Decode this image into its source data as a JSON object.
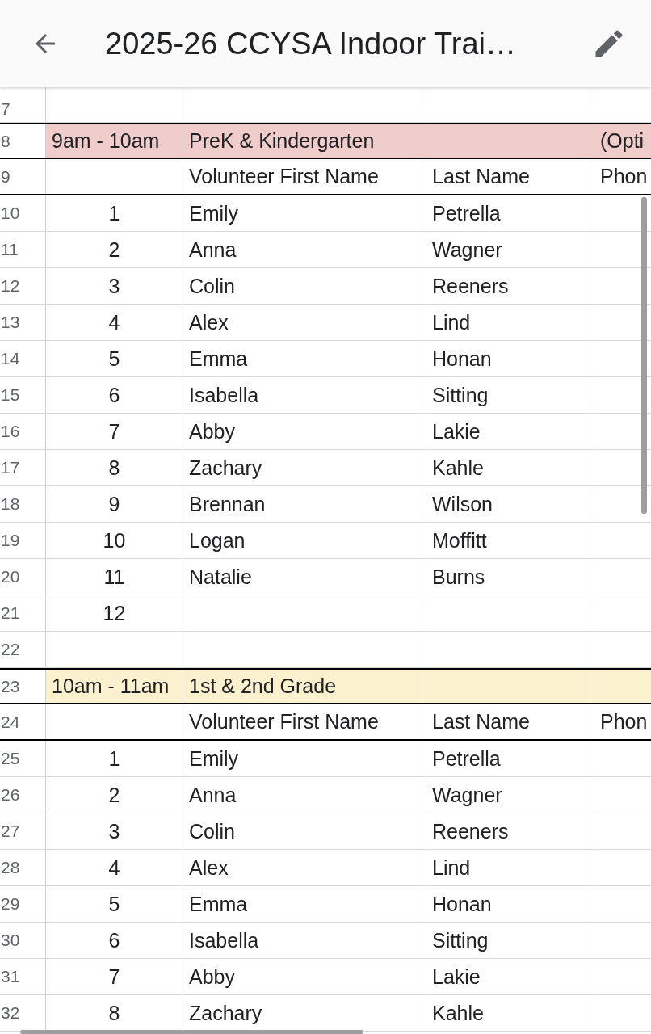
{
  "app_bar": {
    "title": "2025-26 CCYSA Indoor Trai…"
  },
  "rows": [
    {
      "kind": "blank",
      "number": "7"
    },
    {
      "kind": "section",
      "number": "8",
      "time": "9am - 10am",
      "title": "PreK & Kindergarten",
      "note": "(Opti",
      "color": "#f0cccb"
    },
    {
      "kind": "header",
      "number": "9",
      "first": "Volunteer First Name",
      "last": "Last Name",
      "phone": "Phon"
    },
    {
      "kind": "entry",
      "number": "10",
      "index": "1",
      "first": "Emily",
      "last": "Petrella"
    },
    {
      "kind": "entry",
      "number": "11",
      "index": "2",
      "first": "Anna",
      "last": "Wagner"
    },
    {
      "kind": "entry",
      "number": "12",
      "index": "3",
      "first": "Colin",
      "last": "Reeners"
    },
    {
      "kind": "entry",
      "number": "13",
      "index": "4",
      "first": "Alex",
      "last": "Lind"
    },
    {
      "kind": "entry",
      "number": "14",
      "index": "5",
      "first": "Emma",
      "last": "Honan"
    },
    {
      "kind": "entry",
      "number": "15",
      "index": "6",
      "first": "Isabella",
      "last": "Sitting"
    },
    {
      "kind": "entry",
      "number": "16",
      "index": "7",
      "first": "Abby",
      "last": "Lakie"
    },
    {
      "kind": "entry",
      "number": "17",
      "index": "8",
      "first": "Zachary",
      "last": "Kahle"
    },
    {
      "kind": "entry",
      "number": "18",
      "index": "9",
      "first": "Brennan",
      "last": "Wilson"
    },
    {
      "kind": "entry",
      "number": "19",
      "index": "10",
      "first": "Logan",
      "last": "Moffitt"
    },
    {
      "kind": "entry",
      "number": "20",
      "index": "11",
      "first": "Natalie",
      "last": "Burns"
    },
    {
      "kind": "entry",
      "number": "21",
      "index": "12"
    },
    {
      "kind": "blank",
      "number": "22"
    },
    {
      "kind": "section",
      "number": "23",
      "time": "10am - 11am",
      "title": "1st & 2nd Grade",
      "color": "#fcf1cf"
    },
    {
      "kind": "header",
      "number": "24",
      "first": "Volunteer First Name",
      "last": "Last Name",
      "phone": "Phon"
    },
    {
      "kind": "entry",
      "number": "25",
      "index": "1",
      "first": "Emily",
      "last": "Petrella"
    },
    {
      "kind": "entry",
      "number": "26",
      "index": "2",
      "first": "Anna",
      "last": "Wagner"
    },
    {
      "kind": "entry",
      "number": "27",
      "index": "3",
      "first": "Colin",
      "last": "Reeners"
    },
    {
      "kind": "entry",
      "number": "28",
      "index": "4",
      "first": "Alex",
      "last": "Lind"
    },
    {
      "kind": "entry",
      "number": "29",
      "index": "5",
      "first": "Emma",
      "last": "Honan"
    },
    {
      "kind": "entry",
      "number": "30",
      "index": "6",
      "first": "Isabella",
      "last": "Sitting"
    },
    {
      "kind": "entry",
      "number": "31",
      "index": "7",
      "first": "Abby",
      "last": "Lakie"
    },
    {
      "kind": "entry",
      "number": "32",
      "index": "8",
      "first": "Zachary",
      "last": "Kahle"
    }
  ]
}
